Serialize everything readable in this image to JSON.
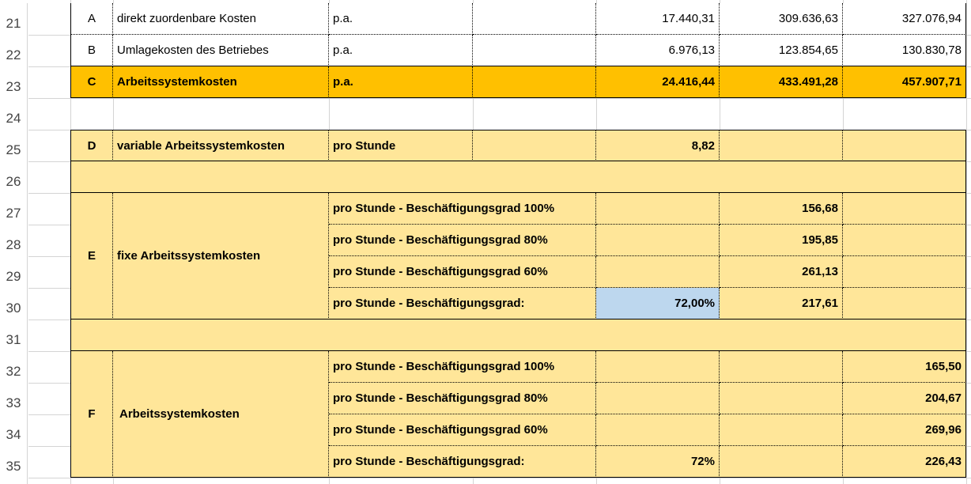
{
  "row_numbers": [
    "21",
    "22",
    "23",
    "24",
    "25",
    "26",
    "27",
    "28",
    "29",
    "30",
    "31",
    "32",
    "33",
    "34",
    "35"
  ],
  "rows": {
    "r21": {
      "code": "A",
      "label": "direkt zuordenbare Kosten",
      "unit": "p.a.",
      "v1": "17.440,31",
      "v2": "309.636,63",
      "v3": "327.076,94"
    },
    "r22": {
      "code": "B",
      "label": "Umlagekosten des Betriebes",
      "unit": "p.a.",
      "v1": "6.976,13",
      "v2": "123.854,65",
      "v3": "130.830,78"
    },
    "r23": {
      "code": "C",
      "label": "Arbeitssystemkosten",
      "unit": "p.a.",
      "v1": "24.416,44",
      "v2": "433.491,28",
      "v3": "457.907,71"
    },
    "r25": {
      "code": "D",
      "label": "variable Arbeitssystemkosten",
      "unit": "pro Stunde",
      "v1": "8,82"
    },
    "blockE": {
      "code": "E",
      "label": "fixe Arbeitssystemkosten",
      "lines": [
        {
          "label": "pro Stunde - Beschäftigungsgrad 100%",
          "value": "156,68"
        },
        {
          "label": "pro Stunde - Beschäftigungsgrad 80%",
          "value": "195,85"
        },
        {
          "label": "pro Stunde - Beschäftigungsgrad 60%",
          "value": "261,13"
        },
        {
          "label": "pro Stunde - Beschäftigungsgrad:",
          "input": "72,00%",
          "value": "217,61"
        }
      ]
    },
    "blockF": {
      "code": "F",
      "label": "Arbeitssystemkosten",
      "lines": [
        {
          "label": "pro Stunde - Beschäftigungsgrad 100%",
          "value": "165,50"
        },
        {
          "label": "pro Stunde - Beschäftigungsgrad 80%",
          "value": "204,67"
        },
        {
          "label": "pro Stunde - Beschäftigungsgrad 60%",
          "value": "269,96"
        },
        {
          "label": "pro Stunde - Beschäftigungsgrad:",
          "input": "72%",
          "value": "226,43"
        }
      ]
    }
  },
  "colors": {
    "highlight": "#ffc000",
    "block": "#ffe699",
    "input": "#bdd7ee"
  }
}
